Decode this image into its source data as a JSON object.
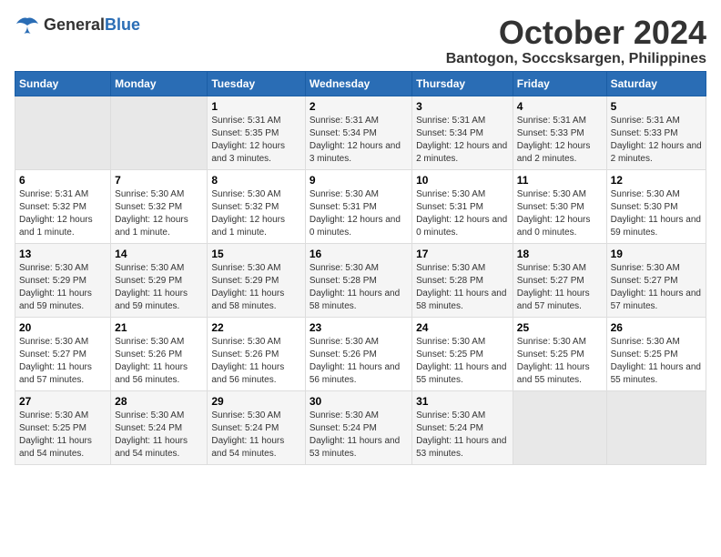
{
  "logo": {
    "general": "General",
    "blue": "Blue"
  },
  "title": {
    "month": "October 2024",
    "location": "Bantogon, Soccsksargen, Philippines"
  },
  "headers": [
    "Sunday",
    "Monday",
    "Tuesday",
    "Wednesday",
    "Thursday",
    "Friday",
    "Saturday"
  ],
  "weeks": [
    [
      {
        "day": "",
        "sunrise": "",
        "sunset": "",
        "daylight": ""
      },
      {
        "day": "",
        "sunrise": "",
        "sunset": "",
        "daylight": ""
      },
      {
        "day": "1",
        "sunrise": "Sunrise: 5:31 AM",
        "sunset": "Sunset: 5:35 PM",
        "daylight": "Daylight: 12 hours and 3 minutes."
      },
      {
        "day": "2",
        "sunrise": "Sunrise: 5:31 AM",
        "sunset": "Sunset: 5:34 PM",
        "daylight": "Daylight: 12 hours and 3 minutes."
      },
      {
        "day": "3",
        "sunrise": "Sunrise: 5:31 AM",
        "sunset": "Sunset: 5:34 PM",
        "daylight": "Daylight: 12 hours and 2 minutes."
      },
      {
        "day": "4",
        "sunrise": "Sunrise: 5:31 AM",
        "sunset": "Sunset: 5:33 PM",
        "daylight": "Daylight: 12 hours and 2 minutes."
      },
      {
        "day": "5",
        "sunrise": "Sunrise: 5:31 AM",
        "sunset": "Sunset: 5:33 PM",
        "daylight": "Daylight: 12 hours and 2 minutes."
      }
    ],
    [
      {
        "day": "6",
        "sunrise": "Sunrise: 5:31 AM",
        "sunset": "Sunset: 5:32 PM",
        "daylight": "Daylight: 12 hours and 1 minute."
      },
      {
        "day": "7",
        "sunrise": "Sunrise: 5:30 AM",
        "sunset": "Sunset: 5:32 PM",
        "daylight": "Daylight: 12 hours and 1 minute."
      },
      {
        "day": "8",
        "sunrise": "Sunrise: 5:30 AM",
        "sunset": "Sunset: 5:32 PM",
        "daylight": "Daylight: 12 hours and 1 minute."
      },
      {
        "day": "9",
        "sunrise": "Sunrise: 5:30 AM",
        "sunset": "Sunset: 5:31 PM",
        "daylight": "Daylight: 12 hours and 0 minutes."
      },
      {
        "day": "10",
        "sunrise": "Sunrise: 5:30 AM",
        "sunset": "Sunset: 5:31 PM",
        "daylight": "Daylight: 12 hours and 0 minutes."
      },
      {
        "day": "11",
        "sunrise": "Sunrise: 5:30 AM",
        "sunset": "Sunset: 5:30 PM",
        "daylight": "Daylight: 12 hours and 0 minutes."
      },
      {
        "day": "12",
        "sunrise": "Sunrise: 5:30 AM",
        "sunset": "Sunset: 5:30 PM",
        "daylight": "Daylight: 11 hours and 59 minutes."
      }
    ],
    [
      {
        "day": "13",
        "sunrise": "Sunrise: 5:30 AM",
        "sunset": "Sunset: 5:29 PM",
        "daylight": "Daylight: 11 hours and 59 minutes."
      },
      {
        "day": "14",
        "sunrise": "Sunrise: 5:30 AM",
        "sunset": "Sunset: 5:29 PM",
        "daylight": "Daylight: 11 hours and 59 minutes."
      },
      {
        "day": "15",
        "sunrise": "Sunrise: 5:30 AM",
        "sunset": "Sunset: 5:29 PM",
        "daylight": "Daylight: 11 hours and 58 minutes."
      },
      {
        "day": "16",
        "sunrise": "Sunrise: 5:30 AM",
        "sunset": "Sunset: 5:28 PM",
        "daylight": "Daylight: 11 hours and 58 minutes."
      },
      {
        "day": "17",
        "sunrise": "Sunrise: 5:30 AM",
        "sunset": "Sunset: 5:28 PM",
        "daylight": "Daylight: 11 hours and 58 minutes."
      },
      {
        "day": "18",
        "sunrise": "Sunrise: 5:30 AM",
        "sunset": "Sunset: 5:27 PM",
        "daylight": "Daylight: 11 hours and 57 minutes."
      },
      {
        "day": "19",
        "sunrise": "Sunrise: 5:30 AM",
        "sunset": "Sunset: 5:27 PM",
        "daylight": "Daylight: 11 hours and 57 minutes."
      }
    ],
    [
      {
        "day": "20",
        "sunrise": "Sunrise: 5:30 AM",
        "sunset": "Sunset: 5:27 PM",
        "daylight": "Daylight: 11 hours and 57 minutes."
      },
      {
        "day": "21",
        "sunrise": "Sunrise: 5:30 AM",
        "sunset": "Sunset: 5:26 PM",
        "daylight": "Daylight: 11 hours and 56 minutes."
      },
      {
        "day": "22",
        "sunrise": "Sunrise: 5:30 AM",
        "sunset": "Sunset: 5:26 PM",
        "daylight": "Daylight: 11 hours and 56 minutes."
      },
      {
        "day": "23",
        "sunrise": "Sunrise: 5:30 AM",
        "sunset": "Sunset: 5:26 PM",
        "daylight": "Daylight: 11 hours and 56 minutes."
      },
      {
        "day": "24",
        "sunrise": "Sunrise: 5:30 AM",
        "sunset": "Sunset: 5:25 PM",
        "daylight": "Daylight: 11 hours and 55 minutes."
      },
      {
        "day": "25",
        "sunrise": "Sunrise: 5:30 AM",
        "sunset": "Sunset: 5:25 PM",
        "daylight": "Daylight: 11 hours and 55 minutes."
      },
      {
        "day": "26",
        "sunrise": "Sunrise: 5:30 AM",
        "sunset": "Sunset: 5:25 PM",
        "daylight": "Daylight: 11 hours and 55 minutes."
      }
    ],
    [
      {
        "day": "27",
        "sunrise": "Sunrise: 5:30 AM",
        "sunset": "Sunset: 5:25 PM",
        "daylight": "Daylight: 11 hours and 54 minutes."
      },
      {
        "day": "28",
        "sunrise": "Sunrise: 5:30 AM",
        "sunset": "Sunset: 5:24 PM",
        "daylight": "Daylight: 11 hours and 54 minutes."
      },
      {
        "day": "29",
        "sunrise": "Sunrise: 5:30 AM",
        "sunset": "Sunset: 5:24 PM",
        "daylight": "Daylight: 11 hours and 54 minutes."
      },
      {
        "day": "30",
        "sunrise": "Sunrise: 5:30 AM",
        "sunset": "Sunset: 5:24 PM",
        "daylight": "Daylight: 11 hours and 53 minutes."
      },
      {
        "day": "31",
        "sunrise": "Sunrise: 5:30 AM",
        "sunset": "Sunset: 5:24 PM",
        "daylight": "Daylight: 11 hours and 53 minutes."
      },
      {
        "day": "",
        "sunrise": "",
        "sunset": "",
        "daylight": ""
      },
      {
        "day": "",
        "sunrise": "",
        "sunset": "",
        "daylight": ""
      }
    ]
  ]
}
